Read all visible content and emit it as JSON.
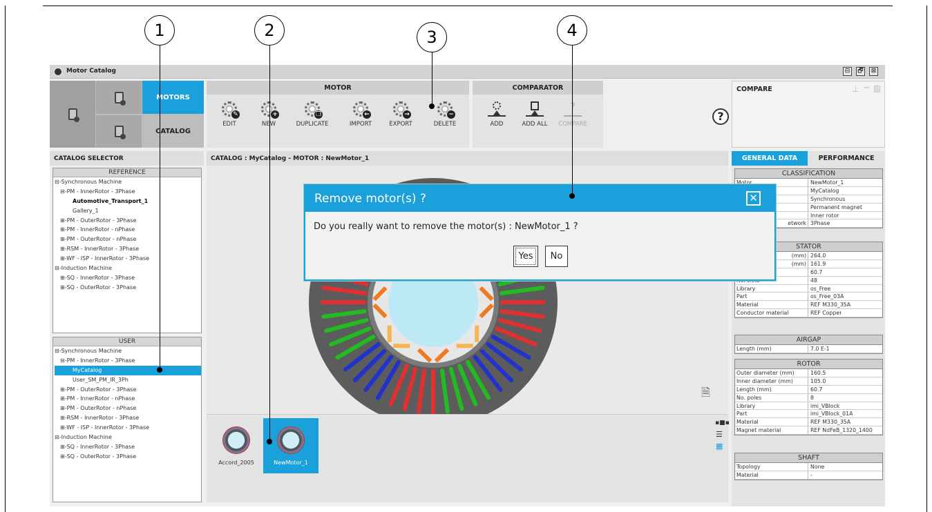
{
  "callouts": [
    "1",
    "2",
    "3",
    "4"
  ],
  "window": {
    "title": "Motor Catalog",
    "buttons": [
      "⊟",
      "🗗",
      "⊠"
    ]
  },
  "nav": {
    "motors": "MOTORS",
    "catalog": "CATALOG"
  },
  "motor_panel": {
    "title": "MOTOR",
    "tools": [
      "EDIT",
      "NEW",
      "DUPLICATE",
      "IMPORT",
      "EXPORT",
      "DELETE"
    ]
  },
  "comparator_panel": {
    "title": "COMPARATOR",
    "tools": [
      "ADD",
      "ADD ALL",
      "COMPARE"
    ]
  },
  "compare_panel": {
    "title": "COMPARE"
  },
  "help": "?",
  "catalog_selector": {
    "title": "CATALOG SELECTOR",
    "reference": {
      "title": "REFERENCE",
      "items": [
        "⊟-Synchronous Machine",
        "⊟-PM - InnerRotor - 3Phase",
        "Automotive_Transport_1",
        "Gallery_1",
        "⊞-PM - OuterRotor - 3Phase",
        "⊞-PM - InnerRotor - nPhase",
        "⊞-PM - OuterRotor - nPhase",
        "⊞-RSM - InnerRotor - 3Phase",
        "⊞-WF - ISP - InnerRotor - 3Phase",
        "⊟-Induction Machine",
        "⊞-SQ - InnerRotor - 3Phase",
        "⊞-SQ - OuterRotor - 3Phase"
      ]
    },
    "user": {
      "title": "USER",
      "items": [
        "⊟-Synchronous Machine",
        "⊟-PM - InnerRotor - 3Phase",
        "MyCatalog",
        "User_SM_PM_IR_3Ph",
        "⊞-PM - OuterRotor - 3Phase",
        "⊞-PM - InnerRotor - nPhase",
        "⊞-PM - OuterRotor - nPhase",
        "⊞-RSM - InnerRotor - 3Phase",
        "⊞-WF - ISP - InnerRotor - 3Phase",
        "⊟-Induction Machine",
        "⊞-SQ - InnerRotor - 3Phase",
        "⊞-SQ - OuterRotor - 3Phase"
      ]
    }
  },
  "breadcrumb": "CATALOG : MyCatalog  -  MOTOR : NewMotor_1",
  "thumbnails": [
    "Accord_2005",
    "NewMotor_1"
  ],
  "right_tabs": {
    "general": "GENERAL DATA",
    "performance": "PERFORMANCE"
  },
  "tables": {
    "classification": {
      "title": "CLASSIFICATION",
      "rows": [
        [
          "Motor",
          "NewMotor_1"
        ],
        [
          "",
          "MyCatalog"
        ],
        [
          "",
          "Synchronous"
        ],
        [
          "",
          "Permanent magnet"
        ],
        [
          "",
          "Inner rotor"
        ],
        [
          "etwork",
          "3Phase"
        ]
      ]
    },
    "stator": {
      "title": "STATOR",
      "rows": [
        [
          "(mm)",
          "264.0"
        ],
        [
          "(mm)",
          "161.9"
        ],
        [
          "",
          "60.7"
        ],
        [
          "No. slots",
          "48"
        ],
        [
          "Library",
          "os_Free"
        ],
        [
          "Part",
          "os_Free_03A"
        ],
        [
          "Material",
          "REF M330_35A"
        ],
        [
          "Conductor material",
          "REF Copper"
        ]
      ]
    },
    "airgap": {
      "title": "AIRGAP",
      "rows": [
        [
          "Length (mm)",
          "7.0 E-1"
        ]
      ]
    },
    "rotor": {
      "title": "ROTOR",
      "rows": [
        [
          "Outer diameter (mm)",
          "160.5"
        ],
        [
          "Inner diameter (mm)",
          "105.0"
        ],
        [
          "Length (mm)",
          "60.7"
        ],
        [
          "No. poles",
          "8"
        ],
        [
          "Library",
          "imi_VBlock"
        ],
        [
          "Part",
          "imi_VBlock_01A"
        ],
        [
          "Material",
          "REF M330_35A"
        ],
        [
          "Magnet material",
          "REF NdFeB_1320_1400"
        ]
      ]
    },
    "shaft": {
      "title": "SHAFT",
      "rows": [
        [
          "Topology",
          "None"
        ],
        [
          "Material",
          "-"
        ]
      ]
    }
  },
  "dialog": {
    "title": "Remove motor(s) ?",
    "message": "Do you really want to remove the motor(s) : NewMotor_1 ?",
    "yes": "Yes",
    "no": "No",
    "close": "✕"
  },
  "colors": {
    "accent": "#1aa0da"
  }
}
